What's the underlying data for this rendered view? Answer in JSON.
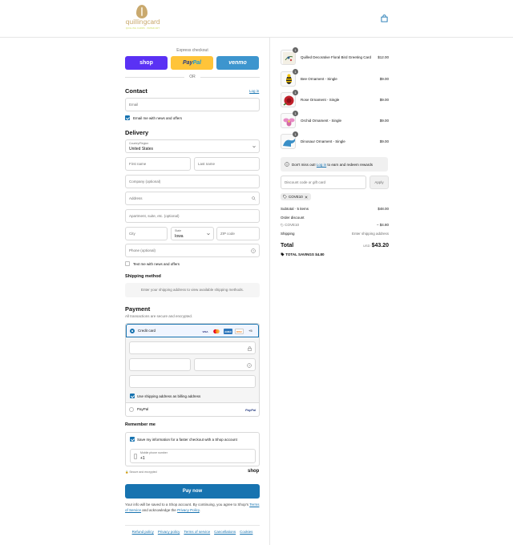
{
  "brand": {
    "name": "quillingcard",
    "tagline": "QUILLING CARDS · PAPER ART"
  },
  "express": {
    "label": "Express checkout",
    "shop": "shop",
    "paypal_a": "Pay",
    "paypal_b": "Pal",
    "venmo": "venmo",
    "or": "OR"
  },
  "contact": {
    "title": "Contact",
    "login_link": "Log in",
    "email_placeholder": "Email",
    "news_label": "Email me with news and offers"
  },
  "delivery": {
    "title": "Delivery",
    "country_label": "Country/Region",
    "country_value": "United States",
    "first_name": "First name",
    "last_name": "Last name",
    "company": "Company (optional)",
    "address": "Address",
    "apartment": "Apartment, suite, etc. (optional)",
    "city": "City",
    "state_label": "State",
    "state_value": "Iowa",
    "zip": "ZIP code",
    "phone": "Phone (optional)",
    "text_me": "Text me with news and offers"
  },
  "shipping": {
    "title": "Shipping method",
    "notice": "Enter your shipping address to view available shipping methods."
  },
  "payment": {
    "title": "Payment",
    "subtitle": "All transactions are secure and encrypted.",
    "credit_card": "Credit card",
    "cards": [
      "VISA",
      "MC",
      "AMEX",
      "DISC"
    ],
    "more_cards": "+5",
    "billing_label": "Use shipping address as billing address",
    "paypal": "PayPal",
    "paypal_logo": "PayPal"
  },
  "remember": {
    "title": "Remember me",
    "save_label": "Save my information for a faster checkout with a Shop account",
    "mobile_label": "Mobile phone number",
    "mobile_value": "+1",
    "secure": "Secure and encrypted",
    "shop_logo": "shop"
  },
  "pay_now": "Pay now",
  "legal": {
    "text": "Your info will be saved to a Shop account. By continuing, you agree to Shop's",
    "terms": "Terms of Service",
    "and": "and acknowledge the",
    "privacy": "Privacy Policy",
    "end": "."
  },
  "footer": [
    "Refund policy",
    "Privacy policy",
    "Terms of service",
    "Cancellations",
    "Cookies"
  ],
  "cart": {
    "items": [
      {
        "qty": "1",
        "name": "Quilled Decorative Floral Bird Greeting Card",
        "price": "$12.00"
      },
      {
        "qty": "1",
        "name": "Bee Ornament - Single",
        "price": "$9.00"
      },
      {
        "qty": "1",
        "name": "Rose Ornament - Single",
        "price": "$9.00"
      },
      {
        "qty": "1",
        "name": "Orchid Ornament - Single",
        "price": "$9.00"
      },
      {
        "qty": "1",
        "name": "Dinosaur Ornament - Single",
        "price": "$9.00"
      }
    ],
    "rewards_a": "Don't miss out!",
    "rewards_link": "Log in",
    "rewards_b": "to earn and redeem rewards",
    "discount_placeholder": "Discount code or gift card",
    "apply": "Apply",
    "code": "COVE10",
    "subtotal_label": "Subtotal · 5 items",
    "subtotal": "$48.00",
    "order_discount": "Order discount",
    "discount_code": "COVE10",
    "discount_value": "− $4.80",
    "shipping_label": "Shipping",
    "shipping_value": "Enter shipping address",
    "total_label": "Total",
    "currency": "USD",
    "total": "$43.20",
    "savings_label": "TOTAL SAVINGS",
    "savings": "$4.80"
  }
}
